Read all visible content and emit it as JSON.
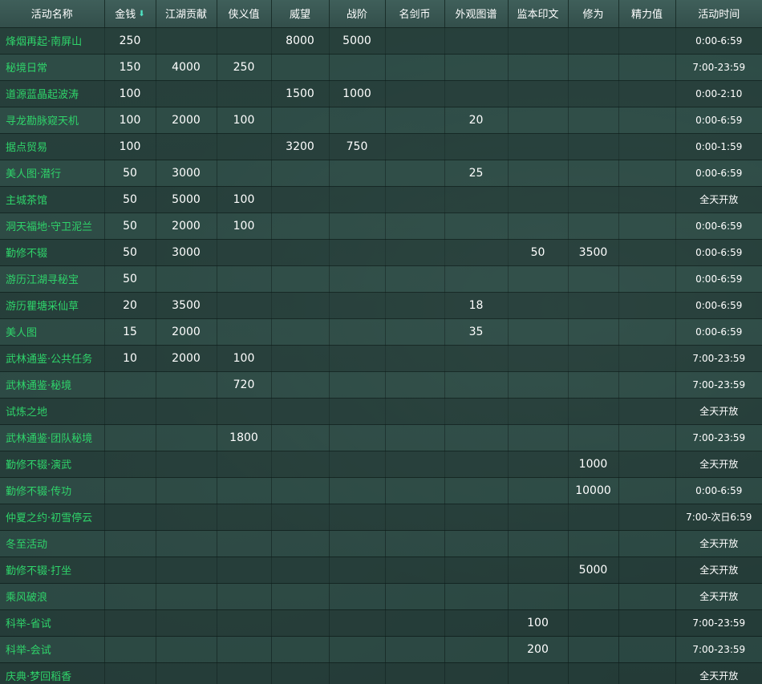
{
  "headers": [
    "活动名称",
    "金钱",
    "江湖贡献",
    "侠义值",
    "威望",
    "战阶",
    "名剑币",
    "外观图谱",
    "监本印文",
    "修为",
    "精力值",
    "活动时间"
  ],
  "sort_icon": "sort-down-icon",
  "colors": {
    "name_text": "#2fd36a",
    "value_text": "#ffffff",
    "header_bg": "#3f5f5a",
    "sort_icon": "#4fe3c3"
  },
  "rows": [
    {
      "name": "烽烟再起·南屏山",
      "money": "250",
      "contribution": "",
      "chivalry": "",
      "prestige": "8000",
      "rank": "5000",
      "sword_coin": "",
      "appearance": "",
      "seal": "",
      "cultivation": "",
      "energy": "",
      "time": "0:00-6:59"
    },
    {
      "name": "秘境日常",
      "money": "150",
      "contribution": "4000",
      "chivalry": "250",
      "prestige": "",
      "rank": "",
      "sword_coin": "",
      "appearance": "",
      "seal": "",
      "cultivation": "",
      "energy": "",
      "time": "7:00-23:59"
    },
    {
      "name": "道源蓝晶起波涛",
      "money": "100",
      "contribution": "",
      "chivalry": "",
      "prestige": "1500",
      "rank": "1000",
      "sword_coin": "",
      "appearance": "",
      "seal": "",
      "cultivation": "",
      "energy": "",
      "time": "0:00-2:10"
    },
    {
      "name": "寻龙勘脉窥天机",
      "money": "100",
      "contribution": "2000",
      "chivalry": "100",
      "prestige": "",
      "rank": "",
      "sword_coin": "",
      "appearance": "20",
      "seal": "",
      "cultivation": "",
      "energy": "",
      "time": "0:00-6:59"
    },
    {
      "name": "据点贸易",
      "money": "100",
      "contribution": "",
      "chivalry": "",
      "prestige": "3200",
      "rank": "750",
      "sword_coin": "",
      "appearance": "",
      "seal": "",
      "cultivation": "",
      "energy": "",
      "time": "0:00-1:59"
    },
    {
      "name": "美人图·潜行",
      "money": "50",
      "contribution": "3000",
      "chivalry": "",
      "prestige": "",
      "rank": "",
      "sword_coin": "",
      "appearance": "25",
      "seal": "",
      "cultivation": "",
      "energy": "",
      "time": "0:00-6:59"
    },
    {
      "name": "主城茶馆",
      "money": "50",
      "contribution": "5000",
      "chivalry": "100",
      "prestige": "",
      "rank": "",
      "sword_coin": "",
      "appearance": "",
      "seal": "",
      "cultivation": "",
      "energy": "",
      "time": "全天开放"
    },
    {
      "name": "洞天福地·守卫泥兰",
      "money": "50",
      "contribution": "2000",
      "chivalry": "100",
      "prestige": "",
      "rank": "",
      "sword_coin": "",
      "appearance": "",
      "seal": "",
      "cultivation": "",
      "energy": "",
      "time": "0:00-6:59"
    },
    {
      "name": "勤修不辍",
      "money": "50",
      "contribution": "3000",
      "chivalry": "",
      "prestige": "",
      "rank": "",
      "sword_coin": "",
      "appearance": "",
      "seal": "50",
      "cultivation": "3500",
      "energy": "",
      "time": "0:00-6:59"
    },
    {
      "name": "游历江湖寻秘宝",
      "money": "50",
      "contribution": "",
      "chivalry": "",
      "prestige": "",
      "rank": "",
      "sword_coin": "",
      "appearance": "",
      "seal": "",
      "cultivation": "",
      "energy": "",
      "time": "0:00-6:59"
    },
    {
      "name": "游历瞿塘采仙草",
      "money": "20",
      "contribution": "3500",
      "chivalry": "",
      "prestige": "",
      "rank": "",
      "sword_coin": "",
      "appearance": "18",
      "seal": "",
      "cultivation": "",
      "energy": "",
      "time": "0:00-6:59"
    },
    {
      "name": "美人图",
      "money": "15",
      "contribution": "2000",
      "chivalry": "",
      "prestige": "",
      "rank": "",
      "sword_coin": "",
      "appearance": "35",
      "seal": "",
      "cultivation": "",
      "energy": "",
      "time": "0:00-6:59"
    },
    {
      "name": "武林通鉴·公共任务",
      "money": "10",
      "contribution": "2000",
      "chivalry": "100",
      "prestige": "",
      "rank": "",
      "sword_coin": "",
      "appearance": "",
      "seal": "",
      "cultivation": "",
      "energy": "",
      "time": "7:00-23:59"
    },
    {
      "name": "武林通鉴·秘境",
      "money": "",
      "contribution": "",
      "chivalry": "720",
      "prestige": "",
      "rank": "",
      "sword_coin": "",
      "appearance": "",
      "seal": "",
      "cultivation": "",
      "energy": "",
      "time": "7:00-23:59"
    },
    {
      "name": "试炼之地",
      "money": "",
      "contribution": "",
      "chivalry": "",
      "prestige": "",
      "rank": "",
      "sword_coin": "",
      "appearance": "",
      "seal": "",
      "cultivation": "",
      "energy": "",
      "time": "全天开放"
    },
    {
      "name": "武林通鉴·团队秘境",
      "money": "",
      "contribution": "",
      "chivalry": "1800",
      "prestige": "",
      "rank": "",
      "sword_coin": "",
      "appearance": "",
      "seal": "",
      "cultivation": "",
      "energy": "",
      "time": "7:00-23:59"
    },
    {
      "name": "勤修不辍·演武",
      "money": "",
      "contribution": "",
      "chivalry": "",
      "prestige": "",
      "rank": "",
      "sword_coin": "",
      "appearance": "",
      "seal": "",
      "cultivation": "1000",
      "energy": "",
      "time": "全天开放"
    },
    {
      "name": "勤修不辍·传功",
      "money": "",
      "contribution": "",
      "chivalry": "",
      "prestige": "",
      "rank": "",
      "sword_coin": "",
      "appearance": "",
      "seal": "",
      "cultivation": "10000",
      "energy": "",
      "time": "0:00-6:59"
    },
    {
      "name": "仲夏之约·初雪停云",
      "money": "",
      "contribution": "",
      "chivalry": "",
      "prestige": "",
      "rank": "",
      "sword_coin": "",
      "appearance": "",
      "seal": "",
      "cultivation": "",
      "energy": "",
      "time": "7:00-次日6:59"
    },
    {
      "name": "冬至活动",
      "money": "",
      "contribution": "",
      "chivalry": "",
      "prestige": "",
      "rank": "",
      "sword_coin": "",
      "appearance": "",
      "seal": "",
      "cultivation": "",
      "energy": "",
      "time": "全天开放"
    },
    {
      "name": "勤修不辍·打坐",
      "money": "",
      "contribution": "",
      "chivalry": "",
      "prestige": "",
      "rank": "",
      "sword_coin": "",
      "appearance": "",
      "seal": "",
      "cultivation": "5000",
      "energy": "",
      "time": "全天开放"
    },
    {
      "name": "乘风破浪",
      "money": "",
      "contribution": "",
      "chivalry": "",
      "prestige": "",
      "rank": "",
      "sword_coin": "",
      "appearance": "",
      "seal": "",
      "cultivation": "",
      "energy": "",
      "time": "全天开放"
    },
    {
      "name": "科举-省试",
      "money": "",
      "contribution": "",
      "chivalry": "",
      "prestige": "",
      "rank": "",
      "sword_coin": "",
      "appearance": "",
      "seal": "100",
      "cultivation": "",
      "energy": "",
      "time": "7:00-23:59"
    },
    {
      "name": "科举-会试",
      "money": "",
      "contribution": "",
      "chivalry": "",
      "prestige": "",
      "rank": "",
      "sword_coin": "",
      "appearance": "",
      "seal": "200",
      "cultivation": "",
      "energy": "",
      "time": "7:00-23:59"
    },
    {
      "name": "庆典·梦回稻香",
      "money": "",
      "contribution": "",
      "chivalry": "",
      "prestige": "",
      "rank": "",
      "sword_coin": "",
      "appearance": "",
      "seal": "",
      "cultivation": "",
      "energy": "",
      "time": "全天开放"
    }
  ]
}
